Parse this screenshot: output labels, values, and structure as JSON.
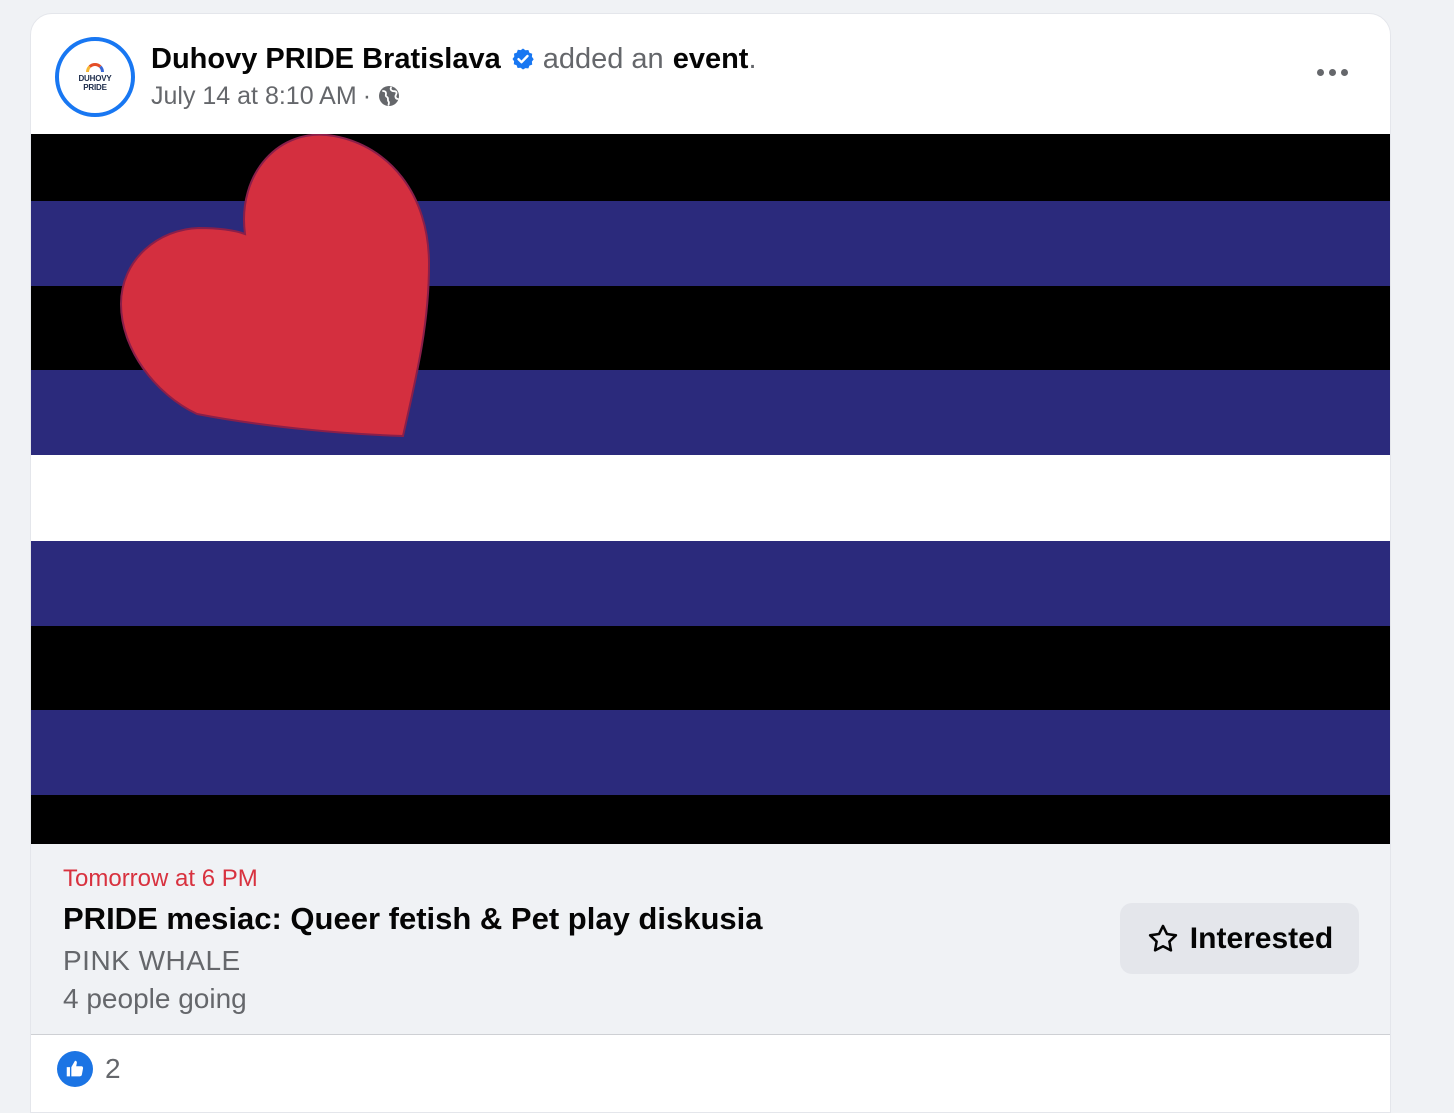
{
  "post": {
    "author": {
      "name": "Duhovy PRIDE Bratislava",
      "avatar_text": "DUHOVY PRIDE",
      "verified": true
    },
    "action_prefix": "added an",
    "action_object": "event",
    "action_suffix": ".",
    "timestamp": "July 14 at 8:10 AM",
    "separator": "·",
    "audience_icon": "globe-icon",
    "more_icon": "more-options-icon"
  },
  "event": {
    "image": "leather-pride-flag",
    "date": "Tomorrow at 6 PM",
    "title": "PRIDE mesiac: Queer fetish & Pet play diskusia",
    "location": "PINK WHALE",
    "going": "4 people going",
    "interested_label": "Interested"
  },
  "reactions": {
    "icon": "like-icon",
    "count": "2"
  },
  "colors": {
    "accent": "#1877f2",
    "date_red": "#d8323f",
    "flag_blue": "#2b2a7c",
    "flag_heart": "#d42f3f",
    "secondary_text": "#65676b",
    "button_bg": "#e4e6eb"
  }
}
